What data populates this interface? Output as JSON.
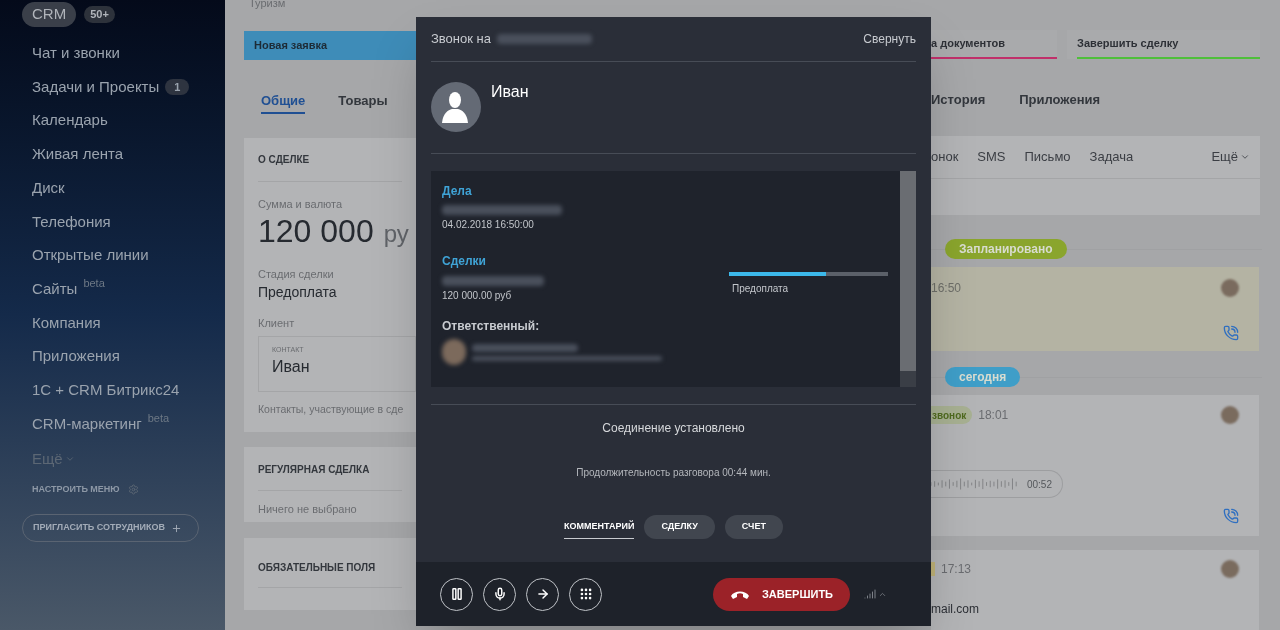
{
  "sidebar": {
    "logo": "CRM",
    "logo_badge": "50+",
    "items": [
      {
        "label": "Чат и звонки"
      },
      {
        "label": "Задачи и Проекты",
        "counter": "1"
      },
      {
        "label": "Календарь"
      },
      {
        "label": "Живая лента"
      },
      {
        "label": "Диск"
      },
      {
        "label": "Телефония"
      },
      {
        "label": "Открытые линии"
      },
      {
        "label": "Сайты",
        "sup": "beta"
      },
      {
        "label": "Компания"
      },
      {
        "label": "Приложения"
      },
      {
        "label": "1С + CRM Битрикс24"
      },
      {
        "label": "CRM-маркетинг",
        "sup": "beta"
      }
    ],
    "more": "Ещё",
    "configure": "НАСТРОИТЬ МЕНЮ",
    "invite": "ПРИГЛАСИТЬ СОТРУДНИКОВ"
  },
  "deal": {
    "category": "Туризм",
    "stages_left": [
      {
        "label": "Новая заявка",
        "color": "#3e8cb8"
      }
    ],
    "stages_right": [
      {
        "label": "а документов",
        "color": "#c0306a"
      },
      {
        "label": "Завершить сделку",
        "color": "#4fbf3a"
      }
    ],
    "tabs_left": [
      {
        "label": "Общие",
        "selected": true
      },
      {
        "label": "Товары",
        "selected": false
      }
    ],
    "tabs_right": [
      {
        "label": "История",
        "selected": false
      },
      {
        "label": "Приложения",
        "selected": false
      }
    ],
    "about": {
      "title": "О СДЕЛКЕ",
      "amount_label": "Сумма и валюта",
      "amount": "120 000",
      "currency": "ру",
      "stage_label": "Стадия сделки",
      "stage": "Предоплата",
      "client_label": "Клиент",
      "contact_caption": "КОНТАКТ",
      "contact_name": "Иван",
      "contacts_note": "Контакты, участвующие в сде"
    },
    "recurring": {
      "title": "РЕГУЛЯРНАЯ СДЕЛКА",
      "value": "Ничего не выбрано"
    },
    "required": {
      "title": "ОБЯЗАТЕЛЬНЫЕ ПОЛЯ"
    },
    "activity_tabs": [
      "онок",
      "SMS",
      "Письмо",
      "Задача"
    ],
    "activity_more": "Ещё",
    "timeline": [
      {
        "kind": "divider",
        "label": "Запланировано",
        "color": "#8aa52d"
      },
      {
        "kind": "planned",
        "time": "16:50"
      },
      {
        "kind": "divider",
        "label": "сегодня",
        "color": "#3f9ec8"
      },
      {
        "kind": "call",
        "tag": "звонок",
        "time": "18:01",
        "duration": "00:52"
      },
      {
        "kind": "email",
        "time": "17:13",
        "text": "mail.com"
      }
    ]
  },
  "call": {
    "title": "Звонок на",
    "minimize": "Свернуть",
    "contact": "Иван",
    "activities_title": "Дела",
    "activity_date": "04.02.2018 16:50:00",
    "deals_title": "Сделки",
    "deal_amount": "120 000.00 руб",
    "deal_stage": "Предоплата",
    "level": 0.61,
    "responsible_title": "Ответственный:",
    "status": "Соединение установлено",
    "duration": "Продолжительность разговора 00:44 мин.",
    "tabs": [
      {
        "label": "КОММЕНТАРИЙ",
        "selected": true
      },
      {
        "label": "СДЕЛКУ",
        "selected": false
      },
      {
        "label": "СЧЕТ",
        "selected": false
      }
    ],
    "controls": [
      {
        "kind": "hold"
      },
      {
        "kind": "mute"
      },
      {
        "kind": "transfer"
      },
      {
        "kind": "keypad"
      }
    ],
    "hangup": "ЗАВЕРШИТЬ"
  }
}
